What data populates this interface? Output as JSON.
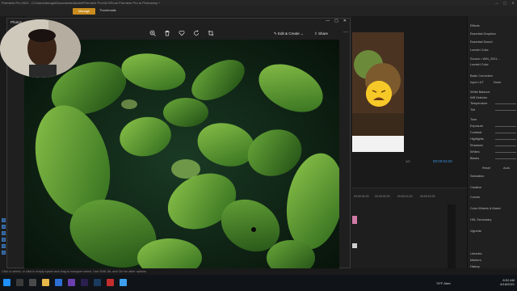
{
  "premiere": {
    "title": "Premiere Pro 2021 - C:\\Users\\dmogo\\Documents\\Adobe\\Premiere Pro\\15.0\\From Premiere Pro to Photoshop *",
    "window_controls": [
      "—",
      "▢",
      "✕"
    ]
  },
  "photos": {
    "app_title": "Photos",
    "tabs": {
      "manage": "Manage",
      "thumbnails": "Thumbnails"
    },
    "toolbar": {
      "zoom_icon": "zoom-in-icon",
      "delete_icon": "trash-icon",
      "favorite_icon": "heart-icon",
      "rotate_icon": "rotate-icon",
      "crop_icon": "crop-icon",
      "edit_create": "Edit & Create",
      "share": "Share",
      "more": "···"
    }
  },
  "program_monitor": {
    "fit": "1/2",
    "timecode": "00:00:53:20"
  },
  "timeline": {
    "ruler": [
      "00:00:04:23",
      "00:00:09:23",
      "00:00:14:23",
      "00:00:19:23"
    ]
  },
  "lumetri": {
    "items": [
      "Effects",
      "Essential Graphics",
      "Essential Sound",
      "Lumetri Color",
      "Source • WIN_2021...",
      "Lumetri Color",
      "Basic Correction",
      "Input LUT",
      "None",
      "White Balance",
      "WB Selector",
      "Temperature",
      "Tint",
      "Tone",
      "Exposure",
      "Contrast",
      "Highlights",
      "Shadows",
      "Whites",
      "Blacks",
      "Reset",
      "Auto",
      "Saturation",
      "Creative",
      "Curves",
      "Color Wheels & Match",
      "HSL Secondary",
      "Vignette",
      "Libraries",
      "Markers",
      "History"
    ]
  },
  "status_bar": "Click to select, or click in empty space and drag to marquee select. Use Shift, Alt, and Ctrl for other options.",
  "taskbar": {
    "weather": "79°F",
    "weather_label": "Alert",
    "time": "8:52 AM",
    "date": "6/18/2021"
  },
  "colors": {
    "accent": "#e8a233",
    "timecode_blue": "#3d8fe0",
    "basil_green": "#4c8f2a"
  }
}
